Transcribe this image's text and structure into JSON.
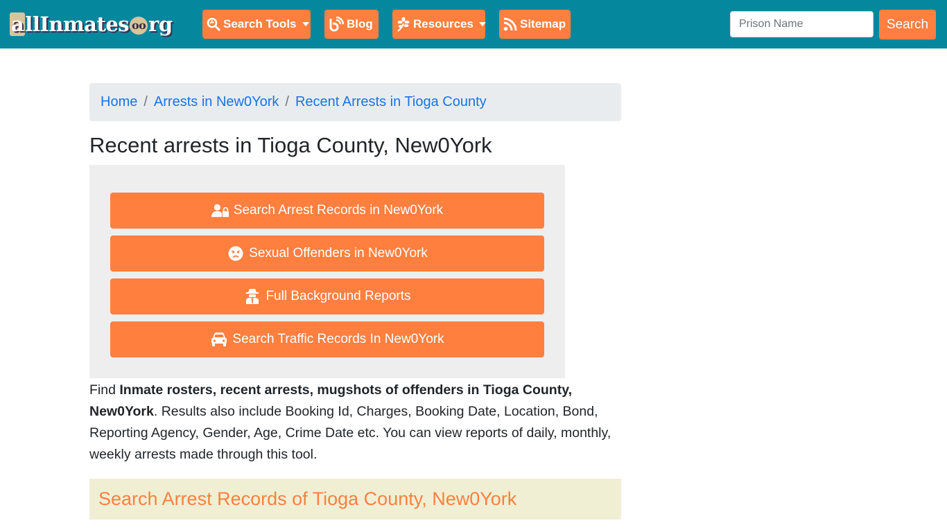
{
  "brand": {
    "logo_text_a": "a",
    "logo_text_main": "llInmates",
    "logo_dot": "oo",
    "logo_tld": "rg",
    "logo_alt": "allInmates.org"
  },
  "nav": {
    "items": [
      {
        "label": "Search Tools",
        "icon": "search-magnify-icon",
        "dropdown": true
      },
      {
        "label": "Blog",
        "icon": "blogger-icon",
        "dropdown": false
      },
      {
        "label": "Resources",
        "icon": "leaf-icon",
        "dropdown": true
      },
      {
        "label": "Sitemap",
        "icon": "rss-icon",
        "dropdown": false
      }
    ],
    "search": {
      "placeholder": "Prison Name",
      "value": "",
      "button_label": "Search"
    }
  },
  "breadcrumb": {
    "items": [
      "Home",
      "Arrests in New0York",
      "Recent Arrests in Tioga County"
    ],
    "separator": "/"
  },
  "page": {
    "title": "Recent arrests in Tioga County, New0York"
  },
  "actions": [
    {
      "label": "Search Arrest Records in New0York",
      "icon": "user-lock-icon"
    },
    {
      "label": "Sexual Offenders in New0York",
      "icon": "angry-face-icon"
    },
    {
      "label": "Full Background Reports",
      "icon": "user-secret-icon"
    },
    {
      "label": "Search Traffic Records In New0York",
      "icon": "car-icon"
    }
  ],
  "description": {
    "prefix": "Find ",
    "bold": "Inmate rosters, recent arrests, mugshots of offenders in Tioga County, New0York",
    "suffix": ". Results also include Booking Id, Charges, Booking Date, Location, Bond, Reporting Agency, Gender, Age, Crime Date etc. You can view reports of daily, monthly, weekly arrests made through this tool."
  },
  "section": {
    "heading": "Search Arrest Records of Tioga County, New0York"
  },
  "colors": {
    "navbar": "#05879e",
    "accent": "#ff7f3f",
    "link": "#1a73e8",
    "breadcrumb_bg": "#e9ecef",
    "panel_bg": "#eeeeee",
    "section_bg": "#f0efd4"
  }
}
